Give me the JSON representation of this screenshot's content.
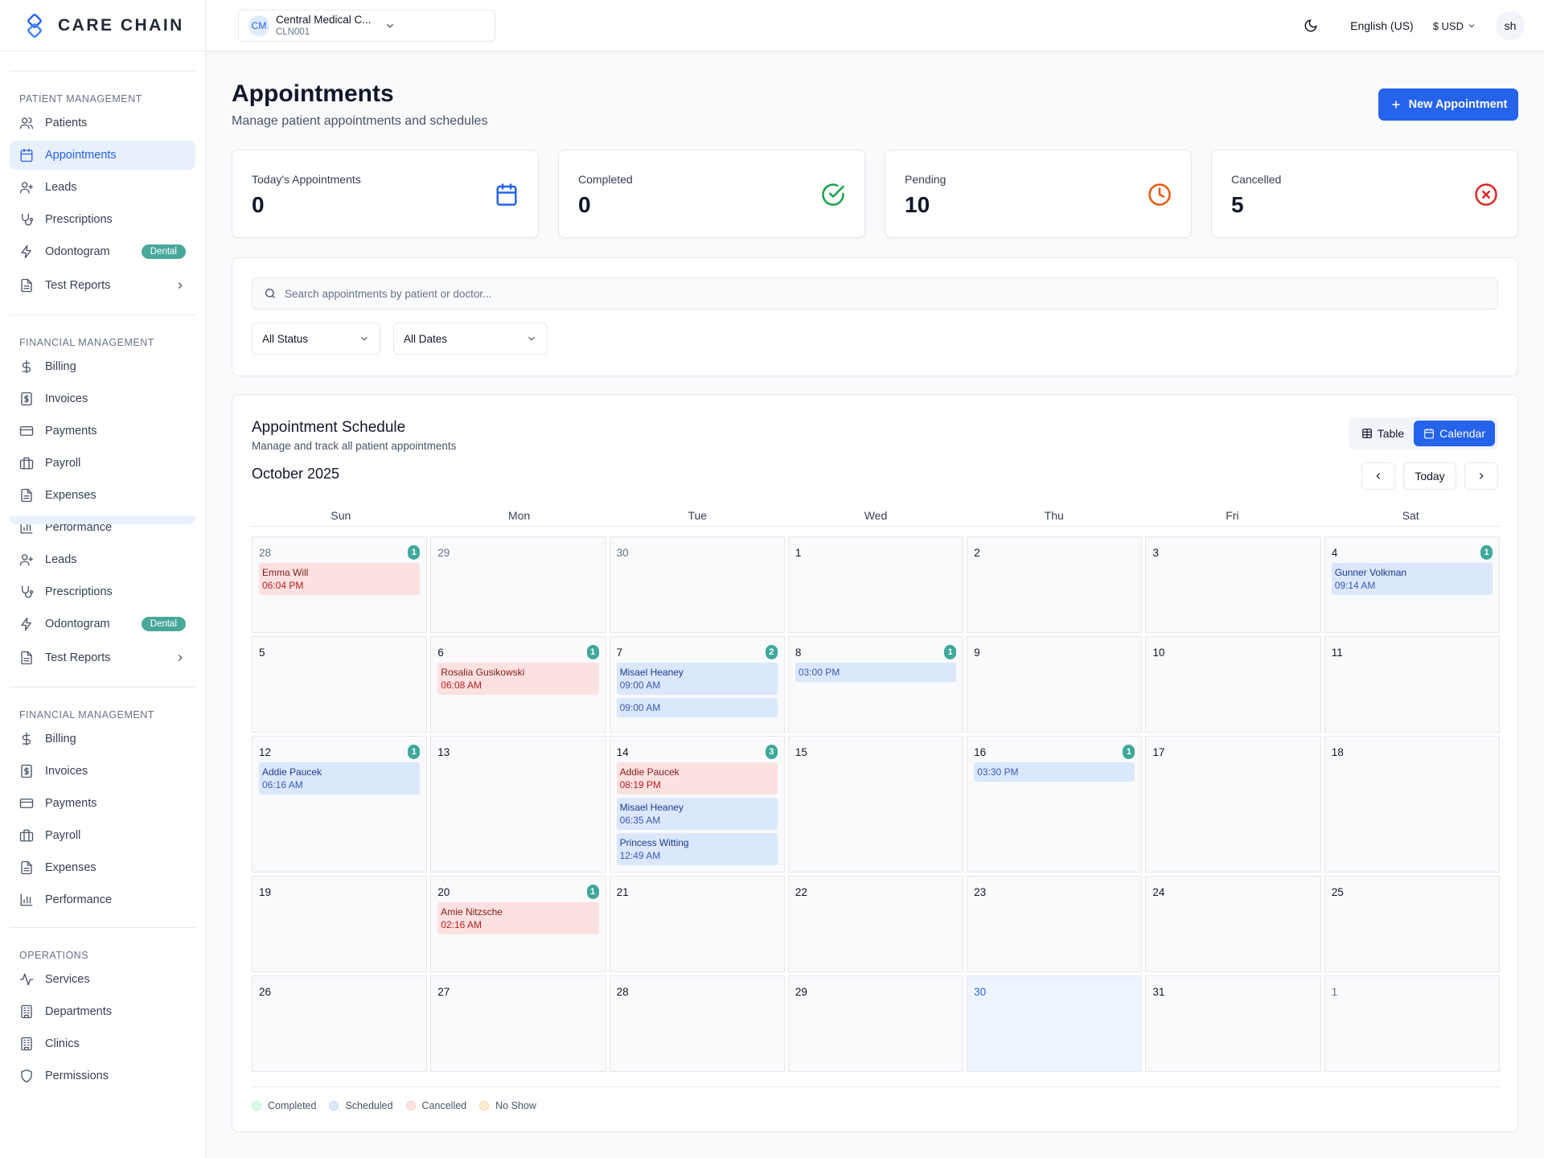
{
  "brand": {
    "name": "CARE CHAIN"
  },
  "sidebar": {
    "sections": [
      {
        "title": "PATIENT MANAGEMENT",
        "items": [
          {
            "label": "Patients",
            "icon": "users-icon"
          },
          {
            "label": "Appointments",
            "icon": "calendar-icon",
            "active": true
          },
          {
            "label": "Leads",
            "icon": "user-plus-icon"
          },
          {
            "label": "Prescriptions",
            "icon": "stethoscope-icon"
          },
          {
            "label": "Odontogram",
            "icon": "zap-icon",
            "badge": "Dental"
          },
          {
            "label": "Test Reports",
            "icon": "file-icon",
            "chevron": true
          }
        ]
      },
      {
        "title": "FINANCIAL MANAGEMENT",
        "items": [
          {
            "label": "Billing",
            "icon": "dollar-icon"
          },
          {
            "label": "Invoices",
            "icon": "receipt-icon"
          },
          {
            "label": "Payments",
            "icon": "credit-card-icon"
          },
          {
            "label": "Payroll",
            "icon": "briefcase-icon"
          },
          {
            "label": "Expenses",
            "icon": "file-icon"
          },
          {
            "label": "Performance",
            "icon": "bar-chart-icon"
          }
        ]
      },
      {
        "title": "",
        "items": [
          {
            "label": "Leads",
            "icon": "user-plus-icon"
          },
          {
            "label": "Prescriptions",
            "icon": "stethoscope-icon"
          },
          {
            "label": "Odontogram",
            "icon": "zap-icon",
            "badge": "Dental"
          },
          {
            "label": "Test Reports",
            "icon": "file-icon",
            "chevron": true
          }
        ]
      },
      {
        "title": "FINANCIAL MANAGEMENT",
        "items": [
          {
            "label": "Billing",
            "icon": "dollar-icon"
          },
          {
            "label": "Invoices",
            "icon": "receipt-icon"
          },
          {
            "label": "Payments",
            "icon": "credit-card-icon"
          },
          {
            "label": "Payroll",
            "icon": "briefcase-icon"
          },
          {
            "label": "Expenses",
            "icon": "file-icon"
          },
          {
            "label": "Performance",
            "icon": "bar-chart-icon"
          }
        ]
      },
      {
        "title": "OPERATIONS",
        "items": [
          {
            "label": "Services",
            "icon": "activity-icon"
          },
          {
            "label": "Departments",
            "icon": "building-icon"
          },
          {
            "label": "Clinics",
            "icon": "building-icon"
          },
          {
            "label": "Permissions",
            "icon": "shield-icon"
          }
        ]
      }
    ]
  },
  "header": {
    "clinic": {
      "initials": "CM",
      "name": "Central Medical C...",
      "code": "CLN001"
    },
    "language": "English (US)",
    "currency": "$ USD",
    "user_initials": "sh"
  },
  "page": {
    "title": "Appointments",
    "subtitle": "Manage patient appointments and schedules",
    "new_button": "New Appointment"
  },
  "stats": [
    {
      "label": "Today's Appointments",
      "value": "0",
      "icon": "calendar-icon",
      "color": "#2563eb"
    },
    {
      "label": "Completed",
      "value": "0",
      "icon": "check-circle-icon",
      "color": "#16a34a"
    },
    {
      "label": "Pending",
      "value": "10",
      "icon": "clock-icon",
      "color": "#ea580c"
    },
    {
      "label": "Cancelled",
      "value": "5",
      "icon": "x-circle-icon",
      "color": "#dc2626"
    }
  ],
  "filters": {
    "search_placeholder": "Search appointments by patient or doctor...",
    "status": "All Status",
    "dates": "All Dates"
  },
  "schedule": {
    "title": "Appointment Schedule",
    "subtitle": "Manage and track all patient appointments",
    "view_table": "Table",
    "view_calendar": "Calendar",
    "month": "October 2025",
    "today_label": "Today",
    "weekdays": [
      "Sun",
      "Mon",
      "Tue",
      "Wed",
      "Thu",
      "Fri",
      "Sat"
    ],
    "weeks": [
      [
        {
          "day": "28",
          "muted": true,
          "count": "1",
          "appts": [
            {
              "name": "Emma Will",
              "time": "06:04 PM",
              "status": "cancelled"
            }
          ]
        },
        {
          "day": "29",
          "muted": true,
          "appts": []
        },
        {
          "day": "30",
          "muted": true,
          "appts": []
        },
        {
          "day": "1",
          "appts": []
        },
        {
          "day": "2",
          "appts": []
        },
        {
          "day": "3",
          "appts": []
        },
        {
          "day": "4",
          "count": "1",
          "appts": [
            {
              "name": "Gunner Volkman",
              "time": "09:14 AM",
              "status": "scheduled"
            }
          ]
        }
      ],
      [
        {
          "day": "5",
          "appts": []
        },
        {
          "day": "6",
          "count": "1",
          "appts": [
            {
              "name": "Rosalia Gusikowski",
              "time": "06:08 AM",
              "status": "cancelled"
            }
          ]
        },
        {
          "day": "7",
          "count": "2",
          "appts": [
            {
              "name": "Misael Heaney",
              "time": "09:00 AM",
              "status": "scheduled"
            },
            {
              "name": "",
              "time": "09:00 AM",
              "status": "scheduled"
            }
          ]
        },
        {
          "day": "8",
          "count": "1",
          "appts": [
            {
              "name": "",
              "time": "03:00 PM",
              "status": "scheduled"
            }
          ]
        },
        {
          "day": "9",
          "appts": []
        },
        {
          "day": "10",
          "appts": []
        },
        {
          "day": "11",
          "appts": []
        }
      ],
      [
        {
          "day": "12",
          "count": "1",
          "appts": [
            {
              "name": "Addie Paucek",
              "time": "06:16 AM",
              "status": "scheduled"
            }
          ]
        },
        {
          "day": "13",
          "appts": []
        },
        {
          "day": "14",
          "count": "3",
          "appts": [
            {
              "name": "Addie Paucek",
              "time": "08:19 PM",
              "status": "cancelled"
            },
            {
              "name": "Misael Heaney",
              "time": "06:35 AM",
              "status": "scheduled"
            },
            {
              "name": "Princess Witting",
              "time": "12:49 AM",
              "status": "scheduled"
            }
          ]
        },
        {
          "day": "15",
          "appts": []
        },
        {
          "day": "16",
          "count": "1",
          "appts": [
            {
              "name": "",
              "time": "03:30 PM",
              "status": "scheduled"
            }
          ]
        },
        {
          "day": "17",
          "appts": []
        },
        {
          "day": "18",
          "appts": []
        }
      ],
      [
        {
          "day": "19",
          "appts": []
        },
        {
          "day": "20",
          "count": "1",
          "appts": [
            {
              "name": "Amie Nitzsche",
              "time": "02:16 AM",
              "status": "cancelled"
            }
          ]
        },
        {
          "day": "21",
          "appts": []
        },
        {
          "day": "22",
          "appts": []
        },
        {
          "day": "23",
          "appts": []
        },
        {
          "day": "24",
          "appts": []
        },
        {
          "day": "25",
          "appts": []
        }
      ],
      [
        {
          "day": "26",
          "appts": []
        },
        {
          "day": "27",
          "appts": []
        },
        {
          "day": "28",
          "appts": []
        },
        {
          "day": "29",
          "appts": []
        },
        {
          "day": "30",
          "today": true,
          "appts": []
        },
        {
          "day": "31",
          "appts": []
        },
        {
          "day": "1",
          "muted": true,
          "appts": []
        }
      ]
    ],
    "legend": [
      {
        "label": "Completed",
        "fill": "#dcfce7",
        "border": "#bbf7d0"
      },
      {
        "label": "Scheduled",
        "fill": "#dbeafe",
        "border": "#bfdbfe"
      },
      {
        "label": "Cancelled",
        "fill": "#fee2e2",
        "border": "#fecaca"
      },
      {
        "label": "No Show",
        "fill": "#ffedd5",
        "border": "#fed7aa"
      }
    ]
  }
}
